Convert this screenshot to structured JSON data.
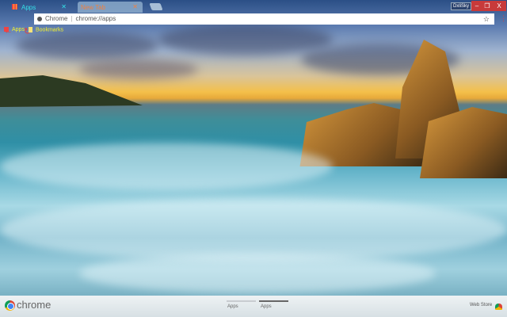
{
  "tabs": [
    {
      "label": "Apps",
      "icon": "apps-grid-icon",
      "active": true
    },
    {
      "label": "New Tab",
      "active": false
    }
  ],
  "profile": "DxliSky",
  "window_controls": {
    "minimize": "–",
    "maximize": "❐",
    "close": "X"
  },
  "omnibox": {
    "site_label": "Chrome",
    "url": "chrome://apps"
  },
  "bookmarks": [
    {
      "label": "Apps",
      "icon": "apps-grid-icon"
    },
    {
      "label": "Bookmarks",
      "icon": "folder-icon"
    }
  ],
  "footer": {
    "brand": "chrome",
    "pages": [
      {
        "label": "Apps",
        "active": false
      },
      {
        "label": "Apps",
        "active": true
      }
    ],
    "web_store": "Web Store"
  },
  "colors": {
    "tab_active_text": "#32e0e8",
    "tab_inactive_text": "#f08040",
    "window_buttons": "#c83a3a",
    "bookmark_text": "#f4f02a"
  }
}
